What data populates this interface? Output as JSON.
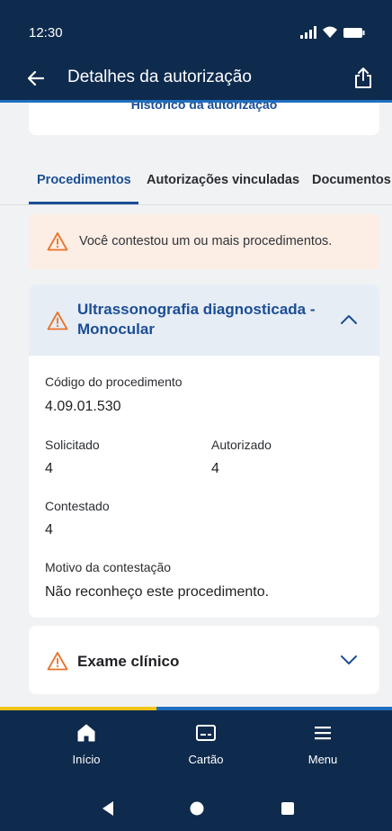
{
  "status_bar": {
    "time": "12:30"
  },
  "app_bar": {
    "title": "Detalhes da autorização"
  },
  "history_card": {
    "link_label": "Histórico da autorização"
  },
  "tabs": [
    {
      "label": "Procedimentos",
      "active": true
    },
    {
      "label": "Autorizações vinculadas",
      "active": false
    },
    {
      "label": "Documentos",
      "active": false
    }
  ],
  "alert": {
    "text": "Você contestou um ou mais procedimentos."
  },
  "procedure": {
    "title": "Ultrassonografia diagnosticada - Monocular",
    "code_label": "Código do procedimento",
    "code_value": "4.09.01.530",
    "requested_label": "Solicitado",
    "requested_value": "4",
    "authorized_label": "Autorizado",
    "authorized_value": "4",
    "contested_label": "Contestado",
    "contested_value": "4",
    "reason_label": "Motivo da contestação",
    "reason_value": "Não reconheço este procedimento."
  },
  "second_procedure": {
    "title": "Exame clínico"
  },
  "scroll_progress_fraction": 0.4,
  "bottom_nav": {
    "items": [
      {
        "label": "Início",
        "icon": "home-icon"
      },
      {
        "label": "Cartão",
        "icon": "card-icon"
      },
      {
        "label": "Menu",
        "icon": "menu-icon"
      }
    ]
  },
  "colors": {
    "primary": "#0e2a4d",
    "link": "#1c4e95",
    "warning": "#e8722a",
    "alert_bg": "#fceee4",
    "progress_fill": "#f2c417"
  }
}
